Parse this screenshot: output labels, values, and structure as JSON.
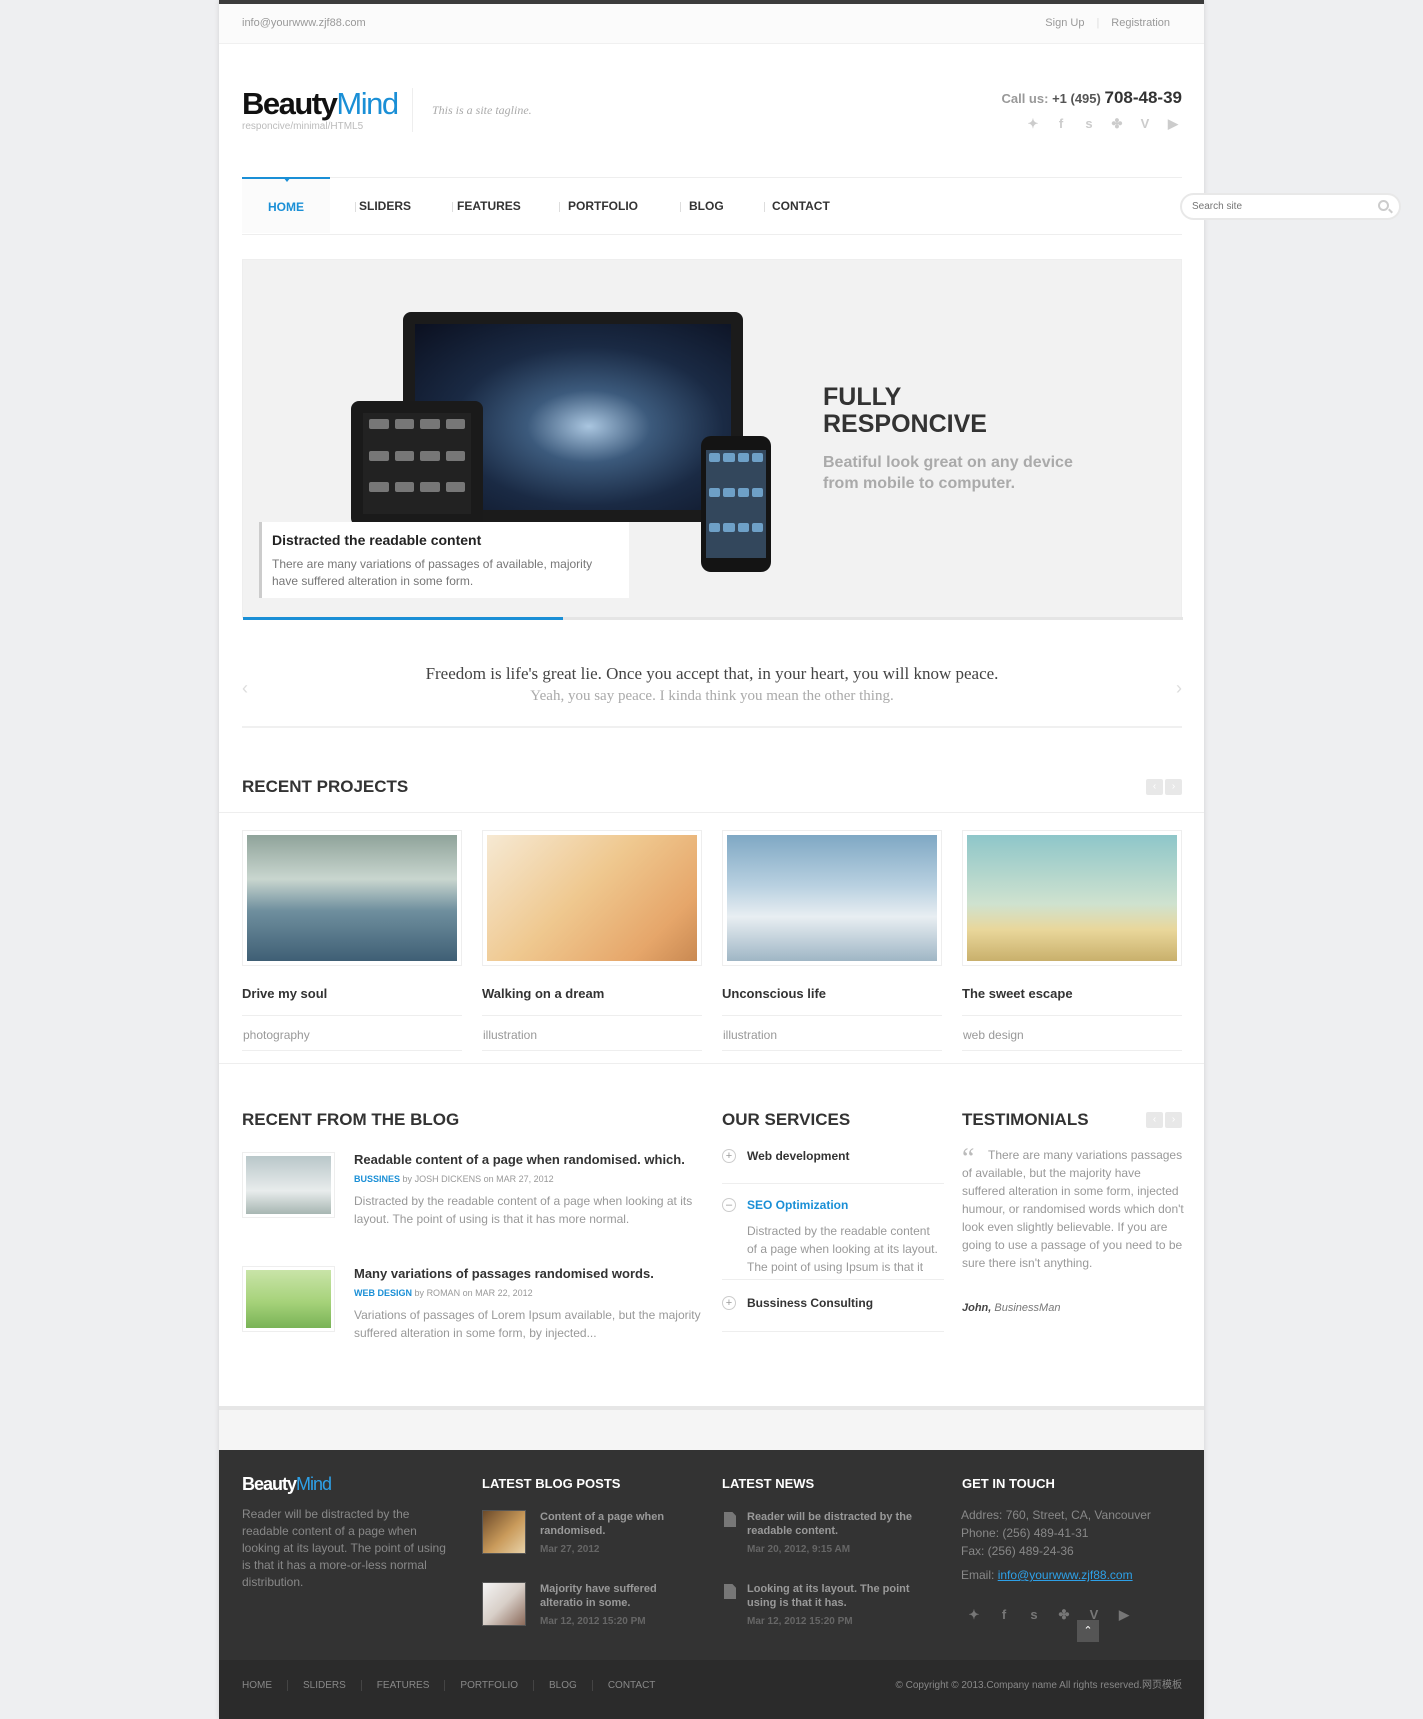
{
  "topbar": {
    "email": "info@yourwww.zjf88.com",
    "signup": "Sign Up",
    "registration": "Registration"
  },
  "header": {
    "logo_a": "Beauty",
    "logo_b": "Mind",
    "logo_sub": "responcive/minimal/HTML5",
    "tagline": "This is a site tagline.",
    "call_label": "Call us:",
    "call_prefix": "+1 (495)",
    "call_number": "708-48-39",
    "social_icons": [
      "twitter-icon",
      "facebook-icon",
      "stumbleupon-icon",
      "myspace-icon",
      "vimeo-icon",
      "youtube-icon"
    ]
  },
  "nav": {
    "items": [
      "HOME",
      "SLIDERS",
      "FEATURES",
      "PORTFOLIO",
      "BLOG",
      "CONTACT"
    ],
    "active": "HOME"
  },
  "search": {
    "placeholder": "Search site"
  },
  "hero": {
    "title_1": "FULLY",
    "title_2": "RESPONCIVE",
    "subtitle_1": "Beatiful look great on any device",
    "subtitle_2": "from mobile to computer.",
    "caption_title": "Distracted the readable content",
    "caption_text": "There are many variations of passages of available, majority have suffered alteration in some form.",
    "slide_progress": 0.34
  },
  "quote": {
    "line1": "Freedom is life's great lie. Once you accept that, in your heart, you will know peace.",
    "line2": "Yeah, you say peace. I kinda think you mean the other thing."
  },
  "projects": {
    "title": "RECENT PROJECTS",
    "items": [
      {
        "name": "Drive my soul",
        "category": "photography"
      },
      {
        "name": "Walking on a dream",
        "category": "illustration"
      },
      {
        "name": "Unconscious life",
        "category": "illustration"
      },
      {
        "name": "The sweet escape",
        "category": "web design"
      }
    ]
  },
  "blog": {
    "title": "RECENT FROM THE BLOG",
    "posts": [
      {
        "title": "Readable content of a page when randomised. which.",
        "category": "BUSSINES",
        "by": "by",
        "author": "JOSH DICKENS",
        "on": "on",
        "date": "MAR 27, 2012",
        "text": "Distracted by the readable content of a page when looking at its layout. The point of using is that it has more normal."
      },
      {
        "title": "Many variations of passages randomised words.",
        "category": "WEB DESIGN",
        "by": "by",
        "author": "ROMAN",
        "on": "on",
        "date": "MAR 22, 2012",
        "text": "Variations of passages of Lorem Ipsum available, but the majority suffered alteration in some form, by injected..."
      }
    ]
  },
  "services": {
    "title": "OUR SERVICES",
    "items": [
      {
        "label": "Web development",
        "icon": "+"
      },
      {
        "label": "SEO Optimization",
        "icon": "–",
        "text": "Distracted by the readable content of a page when looking at its layout. The point of using Ipsum is that it"
      },
      {
        "label": "Bussiness Consulting",
        "icon": "+"
      }
    ]
  },
  "testimonials": {
    "title": "TESTIMONIALS",
    "text": "There are many variations passages of available, but the majority have suffered alteration in some form, injected humour, or randomised words which don't look even slightly believable. If you are going to use a passage of you need to be sure there isn't anything.",
    "author": "John,",
    "role": "BusinessMan"
  },
  "footer": {
    "logo_a": "Beauty",
    "logo_b": "Mind",
    "about": "Reader will be distracted by the readable content of a page when looking at its layout. The point of using is that it has a more-or-less normal distribution.",
    "blog_title": "LATEST BLOG POSTS",
    "blog_posts": [
      {
        "title": "Content of a page when randomised.",
        "date": "Mar 27, 2012"
      },
      {
        "title": "Majority have suffered alteratio in some.",
        "date": "Mar 12, 2012 15:20 PM"
      }
    ],
    "news_title": "LATEST NEWS",
    "news": [
      {
        "title": "Reader will be distracted by the readable content.",
        "date": "Mar 20, 2012, 9:15 AM"
      },
      {
        "title": "Looking at its layout. The point using is that it has.",
        "date": "Mar 12, 2012 15:20 PM"
      }
    ],
    "touch_title": "GET IN TOUCH",
    "address": "Addres: 760, Street, CA, Vancouver",
    "phone": "Phone: (256) 489-41-31",
    "fax": "Fax: (256) 489-24-36",
    "email_label": "Email:",
    "email": "info@yourwww.zjf88.com",
    "nav": [
      "HOME",
      "SLIDERS",
      "FEATURES",
      "PORTFOLIO",
      "BLOG",
      "CONTACT"
    ],
    "copyright": "© Copyright © 2013.Company name All rights reserved.网页模板"
  },
  "colors": {
    "accent": "#1a8fd6",
    "footer_bg": "#333333",
    "text": "#444444"
  }
}
